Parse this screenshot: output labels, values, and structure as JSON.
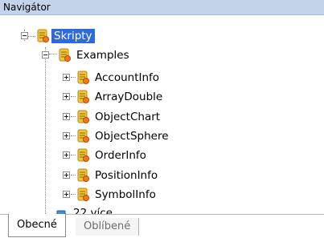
{
  "panel": {
    "title": "Navigátor"
  },
  "tree": {
    "root_label": "Skripty",
    "folder_label": "Examples",
    "items": [
      "AccountInfo",
      "ArrayDouble",
      "ObjectChart",
      "ObjectSphere",
      "OrderInfo",
      "PositionInfo",
      "SymbolInfo"
    ],
    "more_label": "22 více..."
  },
  "tabs": {
    "general": "Obecné",
    "favorites": "Oblíbené"
  },
  "colors": {
    "selection": "#2f6ad8",
    "titlebar": "#c4d3ea"
  },
  "icons": {
    "script": "script-scroll-icon",
    "more": "gear-box-icon",
    "expander": "plus-minus-expander-icon"
  }
}
